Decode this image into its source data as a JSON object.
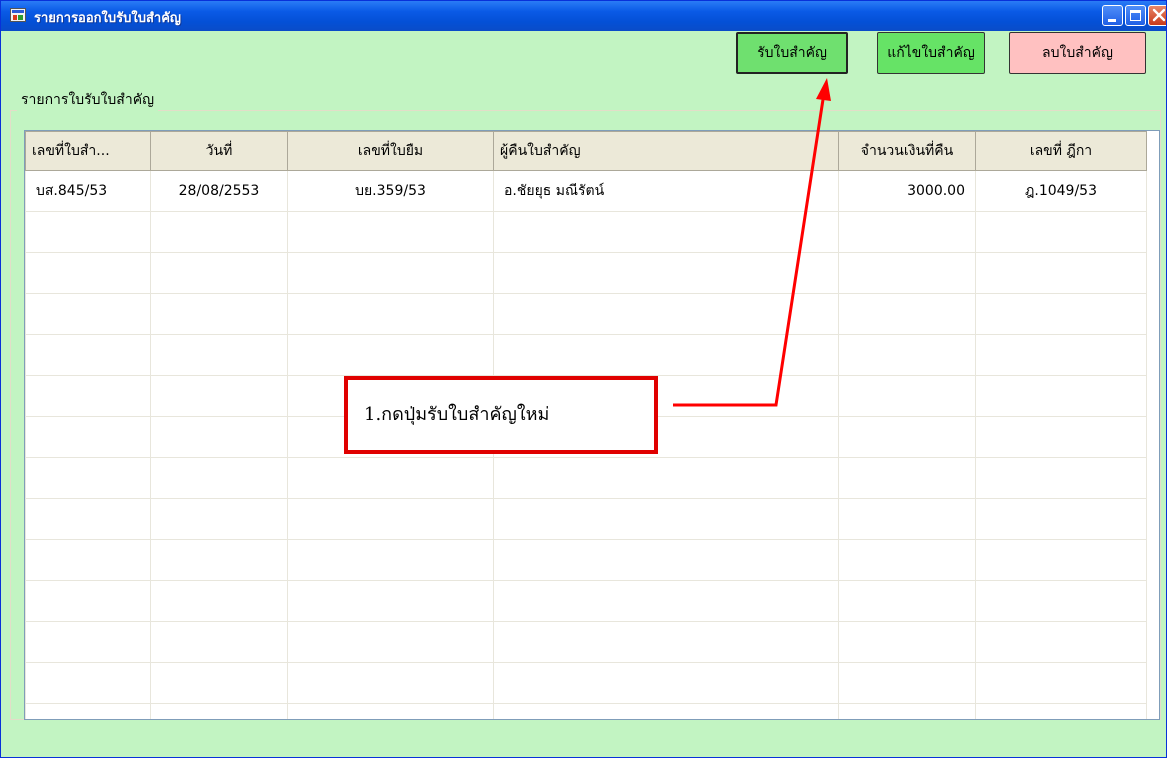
{
  "window": {
    "title": "รายการออกใบรับใบสำคัญ",
    "icon": "app-window-icon",
    "controls": [
      "minimize-icon",
      "maximize-icon",
      "close-icon"
    ]
  },
  "toolbar": {
    "receive_label": "รับใบสำคัญ",
    "edit_label": "แก้ไขใบสำคัญ",
    "delete_label": "ลบใบสำคัญ"
  },
  "group": {
    "legend": "รายการใบรับใบสำคัญ"
  },
  "table": {
    "columns": [
      "เลขที่ใบสำ...",
      "วันที่",
      "เลขที่ใบยืม",
      "ผู้คืนใบสำคัญ",
      "จำนวนเงินที่คืน",
      "เลขที่ ฎีกา"
    ],
    "rows": [
      [
        "บส.845/53",
        "28/08/2553",
        "บย.359/53",
        "อ.ชัยยุธ มณีรัตน์",
        "3000.00",
        "ฎ.1049/53"
      ]
    ]
  },
  "annotation": {
    "text": "1.กดปุ่มรับใบสำคัญใหม่"
  },
  "colors": {
    "background": "#c2f4c2",
    "receive_button": "#6fe06f",
    "edit_button": "#66e366",
    "delete_button": "#ffc1c1",
    "callout_border": "#e00000"
  }
}
